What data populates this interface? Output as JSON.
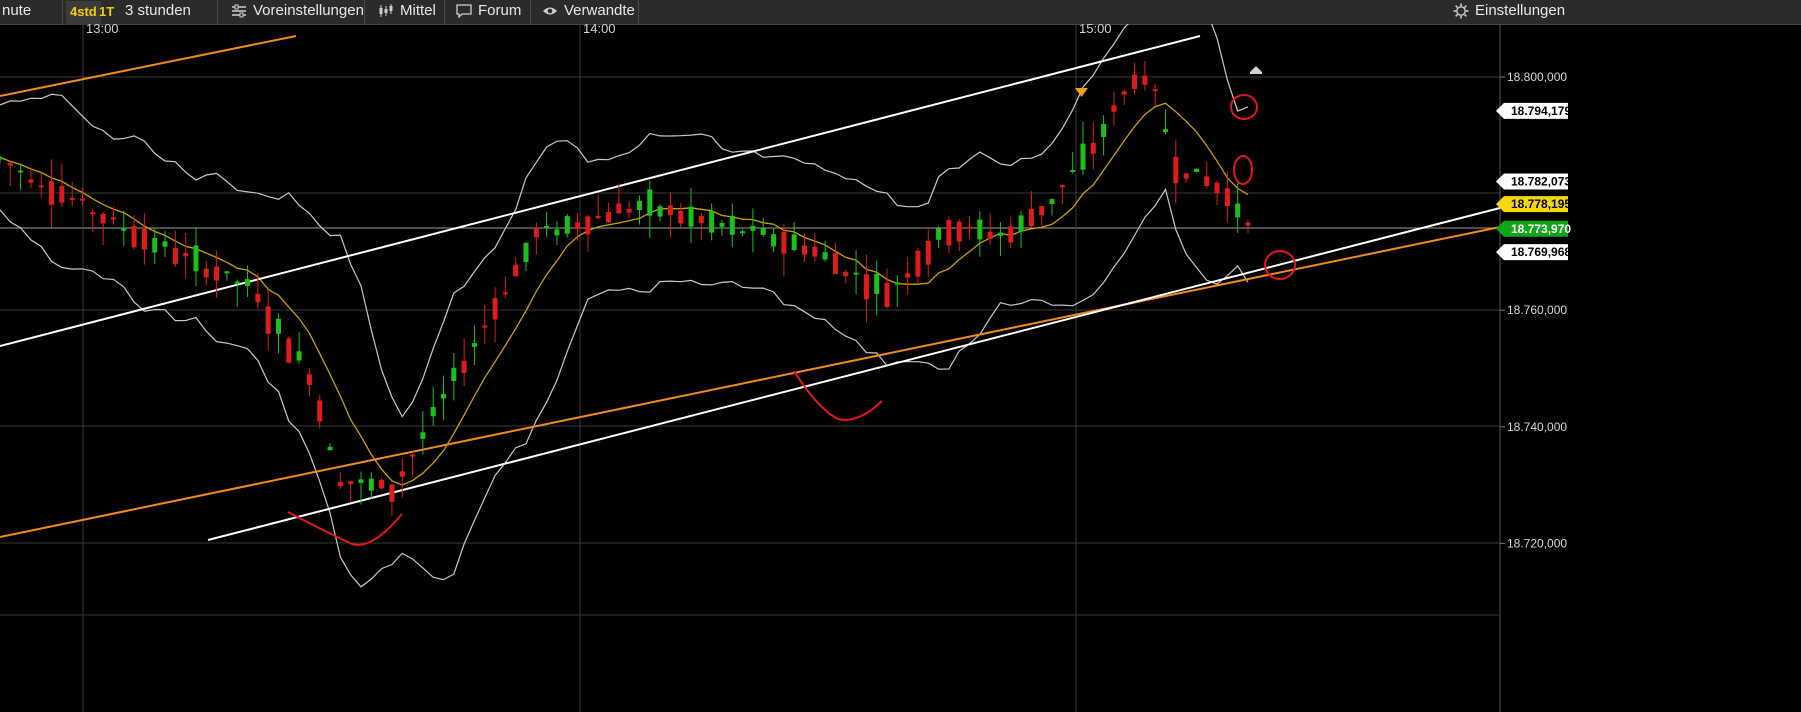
{
  "toolbar": {
    "left_fragment": "nute",
    "timeframe_chip": "4std",
    "timeframe_chip_2": "1T",
    "range_label": "3 stunden",
    "presets_label": "Voreinstellungen",
    "indicator_label": "Mittel",
    "forum_label": "Forum",
    "related_label": "Verwandte",
    "settings_label": "Einstellungen"
  },
  "icons": {
    "presets": "sliders-icon",
    "indicator": "candlestick-icon",
    "forum": "speech-bubble-icon",
    "related": "eye-icon",
    "settings": "gear-icon"
  },
  "chart_data": {
    "type": "candlestick",
    "x_ticks": [
      "13:00",
      "14:00",
      "15:00"
    ],
    "y_ticks": [
      "18.800,000",
      "18.760,000",
      "18.740,000",
      "18.720,000"
    ],
    "price_tags": [
      {
        "label": "18.794,179",
        "value": 18.794179,
        "style": "white"
      },
      {
        "label": "18.782,073",
        "value": 18.782073,
        "style": "white"
      },
      {
        "label": "18.778,195",
        "value": 18.778195,
        "style": "yellow"
      },
      {
        "label": "18.773,970",
        "value": 18.77397,
        "style": "green"
      },
      {
        "label": "18.769,968",
        "value": 18.769968,
        "style": "white"
      }
    ],
    "colors": {
      "up": "#19c219",
      "down": "#e01b1b",
      "moving_average": "#c9a100",
      "bollinger": "#c8c8c8",
      "trend_white": "#ffffff",
      "trend_orange": "#f08a1c",
      "annotation": "#e3161b",
      "grid": "#3a3a3a"
    }
  }
}
